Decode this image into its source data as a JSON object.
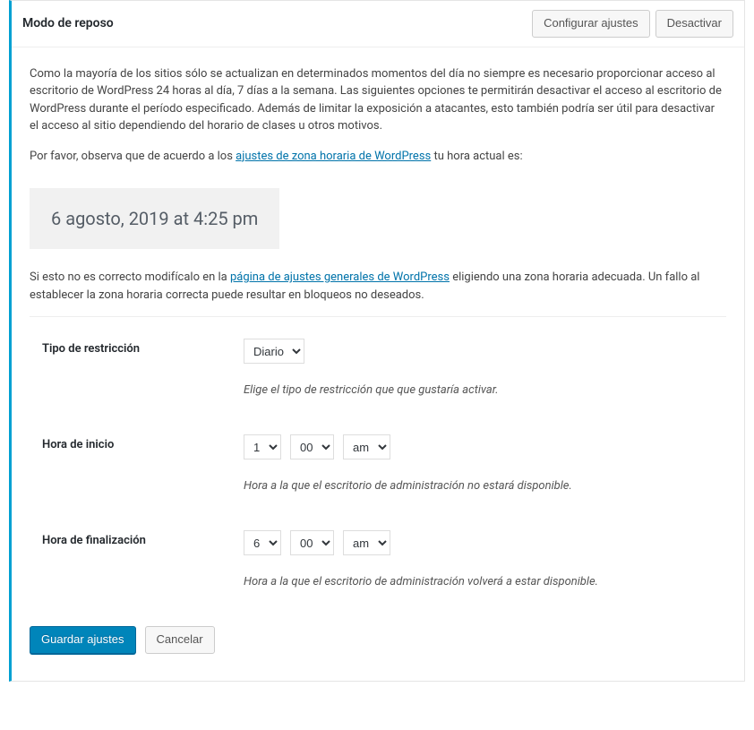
{
  "header": {
    "title": "Modo de reposo",
    "configure_label": "Configurar ajustes",
    "deactivate_label": "Desactivar"
  },
  "intro": {
    "paragraph1": "Como la mayoría de los sitios sólo se actualizan en determinados momentos del día no siempre es necesario proporcionar acceso al escritorio de WordPress 24 horas al día, 7 días a la semana. Las siguientes opciones te permitirán desactivar el acceso al escritorio de WordPress durante el período especificado. Además de limitar la exposición a atacantes, esto también podría ser útil para desactivar el acceso al sitio dependiendo del horario de clases u otros motivos.",
    "p2_before": "Por favor, observa que de acuerdo a los ",
    "p2_link": "ajustes de zona horaria de WordPress",
    "p2_after": " tu hora actual es:",
    "current_time": "6 agosto, 2019 at 4:25 pm",
    "p3_before": "Si esto no es correcto modifícalo en la ",
    "p3_link": "página de ajustes generales de WordPress",
    "p3_after": " eligiendo una zona horaria adecuada. Un fallo al establecer la zona horaria correcta puede resultar en bloqueos no deseados."
  },
  "form": {
    "restriction": {
      "label": "Tipo de restricción",
      "value": "Diario",
      "help": "Elige el tipo de restricción que que gustaría activar."
    },
    "start": {
      "label": "Hora de inicio",
      "hour": "1",
      "minute": "00",
      "ampm": "am",
      "help": "Hora a la que el escritorio de administración no estará disponible."
    },
    "end": {
      "label": "Hora de finalización",
      "hour": "6",
      "minute": "00",
      "ampm": "am",
      "help": "Hora a la que el escritorio de administración volverá a estar disponible."
    }
  },
  "actions": {
    "save": "Guardar ajustes",
    "cancel": "Cancelar"
  }
}
